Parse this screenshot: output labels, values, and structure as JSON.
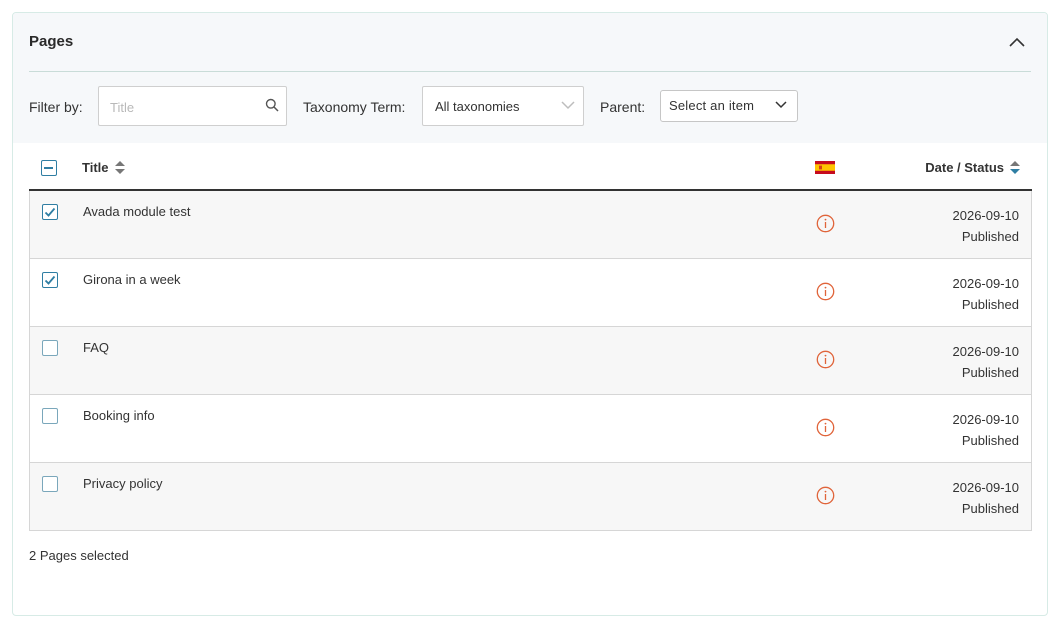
{
  "panel": {
    "title": "Pages",
    "collapse_icon": "chevron-up-icon"
  },
  "filters": {
    "filter_by_label": "Filter by:",
    "search_placeholder": "Title",
    "search_value": "",
    "taxonomy_label": "Taxonomy Term:",
    "taxonomy_value": "All taxonomies",
    "parent_label": "Parent:",
    "parent_value": "Select an item"
  },
  "table": {
    "columns": {
      "title": "Title",
      "language_flag": "spain-flag-icon",
      "date_status": "Date / Status"
    },
    "rows": [
      {
        "title": "Avada module test",
        "checked": true,
        "date": "2026-09-10",
        "status": "Published"
      },
      {
        "title": "Girona in a week",
        "checked": true,
        "date": "2026-09-10",
        "status": "Published"
      },
      {
        "title": "FAQ",
        "checked": false,
        "date": "2026-09-10",
        "status": "Published"
      },
      {
        "title": "Booking info",
        "checked": false,
        "date": "2026-09-10",
        "status": "Published"
      },
      {
        "title": "Privacy policy",
        "checked": false,
        "date": "2026-09-10",
        "status": "Published"
      }
    ]
  },
  "footer": {
    "selected_text": "2 Pages selected"
  },
  "colors": {
    "accent": "#2f7ea3",
    "info_icon": "#e0643a",
    "header_bg": "#f6f8fa"
  }
}
